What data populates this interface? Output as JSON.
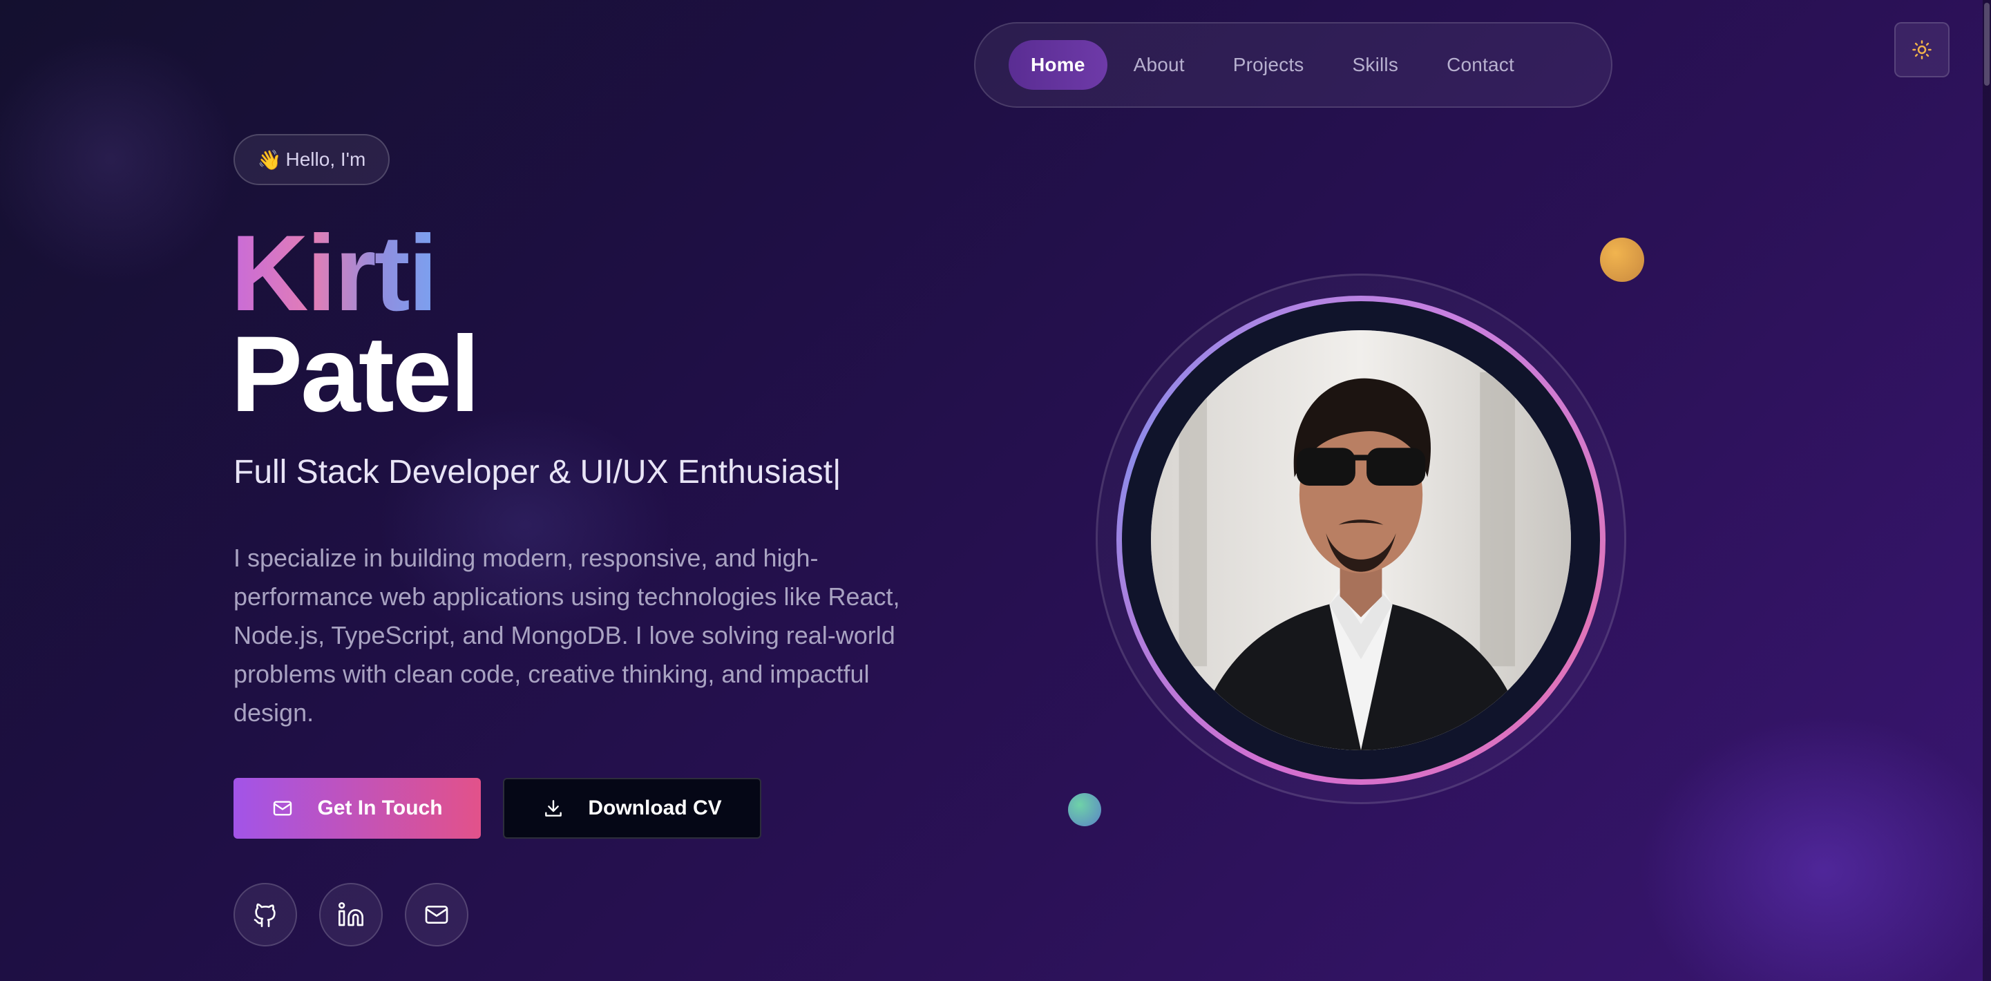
{
  "nav": {
    "items": [
      {
        "label": "Home",
        "active": true
      },
      {
        "label": "About",
        "active": false
      },
      {
        "label": "Projects",
        "active": false
      },
      {
        "label": "Skills",
        "active": false
      },
      {
        "label": "Contact",
        "active": false
      }
    ],
    "theme_toggle_icon": "sun-icon"
  },
  "hero": {
    "badge": {
      "emoji": "👋",
      "text": "Hello, I'm"
    },
    "first_name": "Kirti",
    "last_name": "Patel",
    "role": "Full Stack Developer & UI/UX Enthusiast|",
    "description": "I specialize in building modern, responsive, and high-performance web applications using technologies like React, Node.js, TypeScript, and MongoDB. I love solving real-world problems with clean code, creative thinking, and impactful design.",
    "primary_button": {
      "label": "Get In Touch",
      "icon": "mail-icon"
    },
    "secondary_button": {
      "label": "Download CV",
      "icon": "download-icon"
    },
    "socials": [
      {
        "name": "github",
        "icon": "github-icon"
      },
      {
        "name": "linkedin",
        "icon": "linkedin-icon"
      },
      {
        "name": "email",
        "icon": "mail-icon"
      }
    ]
  },
  "colors": {
    "accent_purple": "#a254e8",
    "accent_pink": "#e2528a",
    "nav_active": "#5a2d93",
    "dot_orange": "#e3a547",
    "dot_teal": "#62b4b0"
  }
}
